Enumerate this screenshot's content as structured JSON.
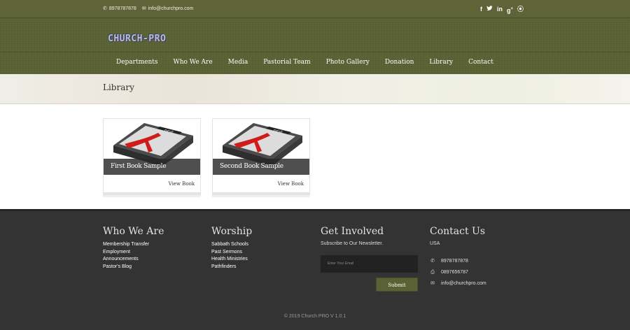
{
  "topbar": {
    "phone": "8978787878",
    "email": "info@churchpro.com",
    "social": [
      "f",
      "t",
      "in",
      "g+",
      "p"
    ]
  },
  "header": {
    "logo_text": "CHURCH-PRO",
    "nav": [
      "Departments",
      "Who We Are",
      "Media",
      "Pastorial Team",
      "Photo Gallery",
      "Donation",
      "Library",
      "Contact"
    ]
  },
  "page": {
    "title": "Library"
  },
  "books": [
    {
      "title": "First Book Sample",
      "link": "View Book",
      "cover_label": "PDF"
    },
    {
      "title": "Second Book Sample",
      "link": "View Book",
      "cover_label": "PDF"
    }
  ],
  "footer": {
    "who_we_are": {
      "title": "Who We Are",
      "items": [
        "Membership Transfer",
        "Employment",
        "Announcements",
        "Pastor's Blog"
      ]
    },
    "worship": {
      "title": "Worship",
      "items": [
        "Sabbath Schools",
        "Past Sermons",
        "Health Ministries",
        "Pathfinders"
      ]
    },
    "get_involved": {
      "title": "Get Involved",
      "subtitle": "Subscribe to Our Newsletter.",
      "placeholder": "Enter Your Email",
      "submit": "Submit"
    },
    "contact": {
      "title": "Contact Us",
      "location": "USA",
      "phone": "8978787878",
      "fax": "0897656787",
      "email": "info@churchpro.com"
    },
    "copyright": "© 2019 Church PRO V 1.0.1"
  },
  "colors": {
    "brand": "#5a6134",
    "footer": "#333333"
  }
}
